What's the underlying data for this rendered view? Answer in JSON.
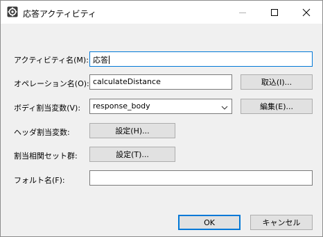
{
  "window": {
    "title": "応答アクティビティ",
    "icon": "gear-app-icon",
    "controls": [
      "minimize-icon",
      "maximize-icon",
      "close-icon"
    ]
  },
  "form": {
    "activity_name": {
      "label": "アクティビティ名(M):",
      "value": "応答"
    },
    "operation_name": {
      "label": "オペレーション名(O):",
      "value": "calculateDistance",
      "button": "取込(I)..."
    },
    "body_variable": {
      "label": "ボディ割当変数(V):",
      "selected": "response_body",
      "button": "編集(E)..."
    },
    "header_variable": {
      "label": "ヘッダ割当変数:",
      "button": "設定(H)..."
    },
    "correlation_set": {
      "label": "割当相関セット群:",
      "button": "設定(T)..."
    },
    "fault_name": {
      "label": "フォルト名(F):",
      "value": ""
    }
  },
  "footer": {
    "ok_label": "OK",
    "cancel_label": "キャンセル"
  },
  "colors": {
    "focus_border": "#0078d7",
    "dialog_bg": "#f0f0f0",
    "button_bg": "#e1e1e1"
  }
}
